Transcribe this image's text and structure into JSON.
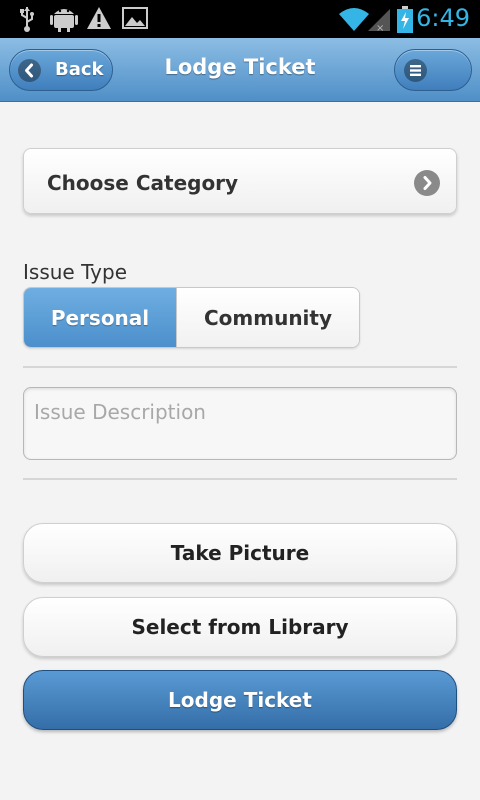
{
  "status_bar": {
    "time": "6:49",
    "icons": [
      "usb-icon",
      "android-debug-icon",
      "warning-icon",
      "image-icon",
      "wifi-icon",
      "signal-icon",
      "battery-icon"
    ]
  },
  "header": {
    "title": "Lodge Ticket",
    "back_label": "Back",
    "accent_color": "#4f8fc7"
  },
  "form": {
    "category_label": "Choose Category",
    "issue_type_label": "Issue Type",
    "issue_types": [
      "Personal",
      "Community"
    ],
    "selected_issue_type": "Personal",
    "description_placeholder": "Issue Description",
    "description_value": ""
  },
  "actions": {
    "take_picture": "Take Picture",
    "select_library": "Select from Library",
    "lodge_ticket": "Lodge Ticket"
  }
}
